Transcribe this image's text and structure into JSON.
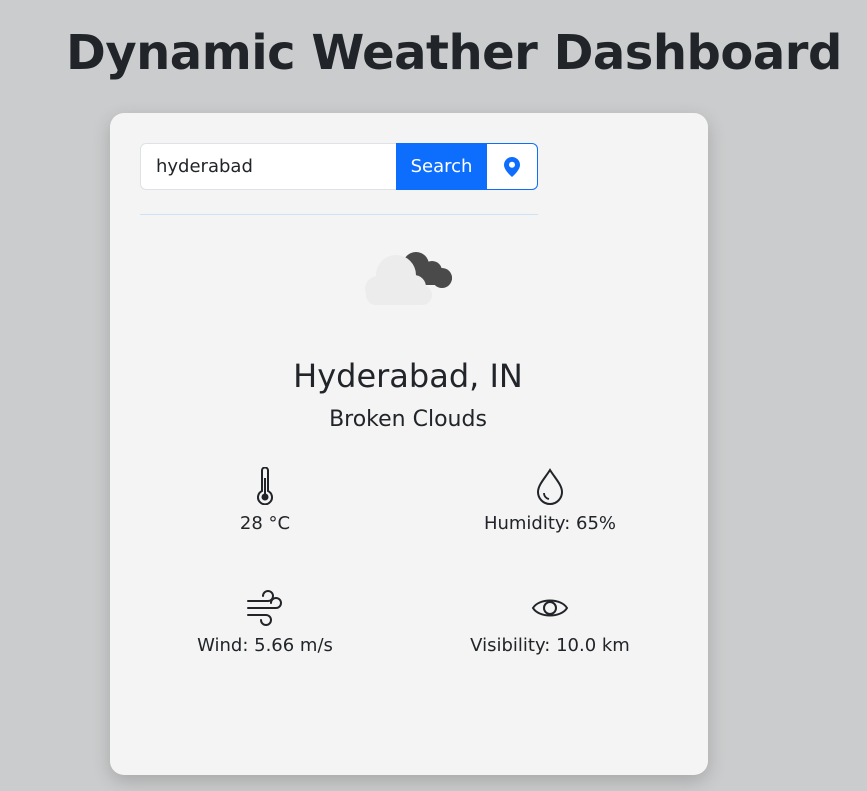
{
  "page": {
    "title": "Dynamic Weather Dashboard"
  },
  "search": {
    "value": "hyderabad",
    "button_label": "Search",
    "location_icon": "map-pin-icon"
  },
  "weather": {
    "icon": "broken-clouds-icon",
    "city": "Hyderabad, IN",
    "condition": "Broken Clouds",
    "stats": {
      "temperature": {
        "icon": "thermometer-icon",
        "text": "28 °C"
      },
      "humidity": {
        "icon": "droplet-icon",
        "text": "Humidity: 65%"
      },
      "wind": {
        "icon": "wind-icon",
        "text": "Wind: 5.66 m/s"
      },
      "visibility": {
        "icon": "eye-icon",
        "text": "Visibility: 10.0 km"
      }
    }
  },
  "colors": {
    "background": "#cbcccd",
    "card": "#f4f4f4",
    "accent": "#0d6efd",
    "text": "#212529"
  }
}
